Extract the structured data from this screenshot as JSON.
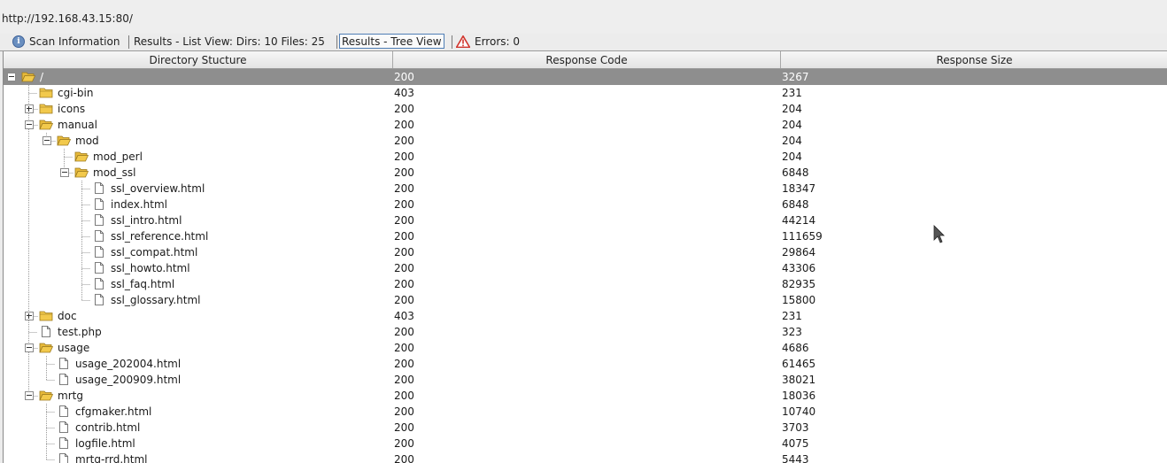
{
  "url": "http://192.168.43.15:80/",
  "tabs": [
    {
      "label": "Scan Information",
      "icon": "info-icon"
    },
    {
      "label": "Results - List View: Dirs: 10 Files: 25"
    },
    {
      "label": "Results - Tree View",
      "selected": true
    },
    {
      "label": "Errors: 0",
      "icon": "warning-icon"
    }
  ],
  "columns": [
    "Directory Stucture",
    "Response Code",
    "Response Size"
  ],
  "rows": [
    {
      "name": "/",
      "depth": 0,
      "type": "folder-open",
      "expander": "minus",
      "code": "200",
      "size": "3267",
      "selected": true
    },
    {
      "name": "cgi-bin",
      "depth": 1,
      "type": "folder",
      "expander": "none",
      "code": "403",
      "size": "231"
    },
    {
      "name": "icons",
      "depth": 1,
      "type": "folder",
      "expander": "plus",
      "code": "200",
      "size": "204"
    },
    {
      "name": "manual",
      "depth": 1,
      "type": "folder-open",
      "expander": "minus",
      "code": "200",
      "size": "204"
    },
    {
      "name": "mod",
      "depth": 2,
      "type": "folder-open",
      "expander": "minus",
      "code": "200",
      "size": "204"
    },
    {
      "name": "mod_perl",
      "depth": 3,
      "type": "folder-open",
      "expander": "none",
      "code": "200",
      "size": "204"
    },
    {
      "name": "mod_ssl",
      "depth": 3,
      "type": "folder-open",
      "expander": "minus",
      "code": "200",
      "size": "6848"
    },
    {
      "name": "ssl_overview.html",
      "depth": 4,
      "type": "file",
      "expander": "none",
      "code": "200",
      "size": "18347"
    },
    {
      "name": "index.html",
      "depth": 4,
      "type": "file",
      "expander": "none",
      "code": "200",
      "size": "6848"
    },
    {
      "name": "ssl_intro.html",
      "depth": 4,
      "type": "file",
      "expander": "none",
      "code": "200",
      "size": "44214"
    },
    {
      "name": "ssl_reference.html",
      "depth": 4,
      "type": "file",
      "expander": "none",
      "code": "200",
      "size": "111659"
    },
    {
      "name": "ssl_compat.html",
      "depth": 4,
      "type": "file",
      "expander": "none",
      "code": "200",
      "size": "29864"
    },
    {
      "name": "ssl_howto.html",
      "depth": 4,
      "type": "file",
      "expander": "none",
      "code": "200",
      "size": "43306"
    },
    {
      "name": "ssl_faq.html",
      "depth": 4,
      "type": "file",
      "expander": "none",
      "code": "200",
      "size": "82935"
    },
    {
      "name": "ssl_glossary.html",
      "depth": 4,
      "type": "file",
      "expander": "none",
      "code": "200",
      "size": "15800"
    },
    {
      "name": "doc",
      "depth": 1,
      "type": "folder",
      "expander": "plus",
      "code": "403",
      "size": "231"
    },
    {
      "name": "test.php",
      "depth": 1,
      "type": "file",
      "expander": "none",
      "code": "200",
      "size": "323"
    },
    {
      "name": "usage",
      "depth": 1,
      "type": "folder-open",
      "expander": "minus",
      "code": "200",
      "size": "4686"
    },
    {
      "name": "usage_202004.html",
      "depth": 2,
      "type": "file",
      "expander": "none",
      "code": "200",
      "size": "61465"
    },
    {
      "name": "usage_200909.html",
      "depth": 2,
      "type": "file",
      "expander": "none",
      "code": "200",
      "size": "38021"
    },
    {
      "name": "mrtg",
      "depth": 1,
      "type": "folder-open",
      "expander": "minus",
      "code": "200",
      "size": "18036"
    },
    {
      "name": "cfgmaker.html",
      "depth": 2,
      "type": "file",
      "expander": "none",
      "code": "200",
      "size": "10740"
    },
    {
      "name": "contrib.html",
      "depth": 2,
      "type": "file",
      "expander": "none",
      "code": "200",
      "size": "3703"
    },
    {
      "name": "logfile.html",
      "depth": 2,
      "type": "file",
      "expander": "none",
      "code": "200",
      "size": "4075"
    },
    {
      "name": "mrtg-rrd.html",
      "depth": 2,
      "type": "file",
      "expander": "none",
      "code": "200",
      "size": "5443"
    }
  ],
  "colors": {
    "selected_row": "#8e8e8e",
    "folder": "#f2c94c",
    "warning": "#d0342c"
  }
}
